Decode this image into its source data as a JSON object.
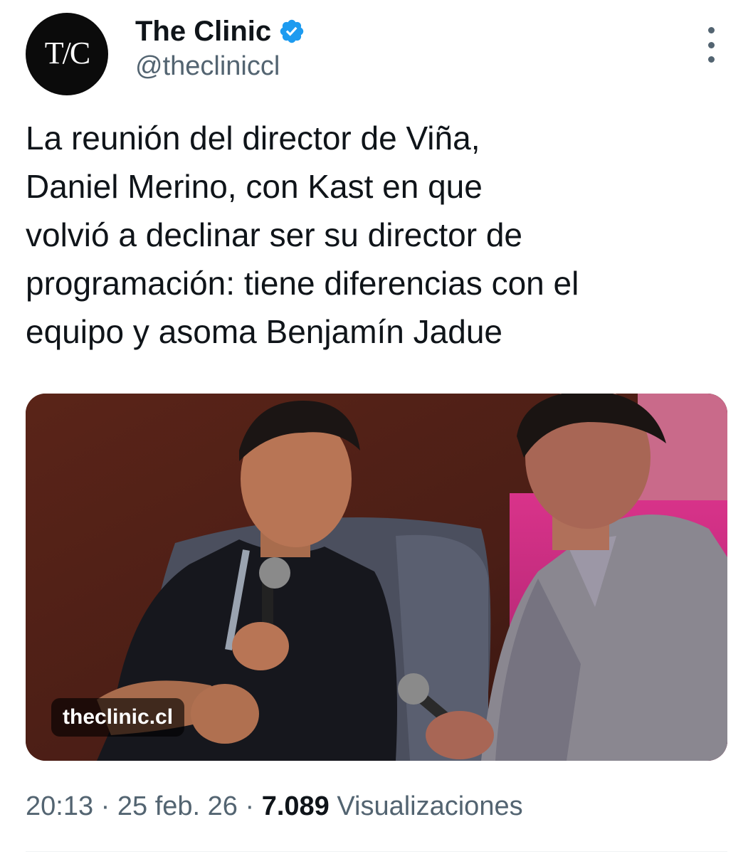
{
  "author": {
    "avatar_text": "T/C",
    "display_name": "The Clinic",
    "handle": "@thecliniccl",
    "verified_icon": "verified-badge-icon",
    "verified_color": "#1d9bf0"
  },
  "tweet": {
    "text": "La reunión del director de Viña,\nDaniel Merino, con Kast en que\nvolvió a declinar ser su director de\nprogramación: tiene diferencias con el\nequipo y asoma Benjamín Jadue"
  },
  "media": {
    "source_label": "theclinic.cl"
  },
  "meta": {
    "time": "20:13",
    "separator": " · ",
    "date": "25 feb. 26",
    "views_count": "7.089",
    "views_label": " Visualizaciones"
  },
  "colors": {
    "text_primary": "#0f1419",
    "text_secondary": "#536471"
  }
}
